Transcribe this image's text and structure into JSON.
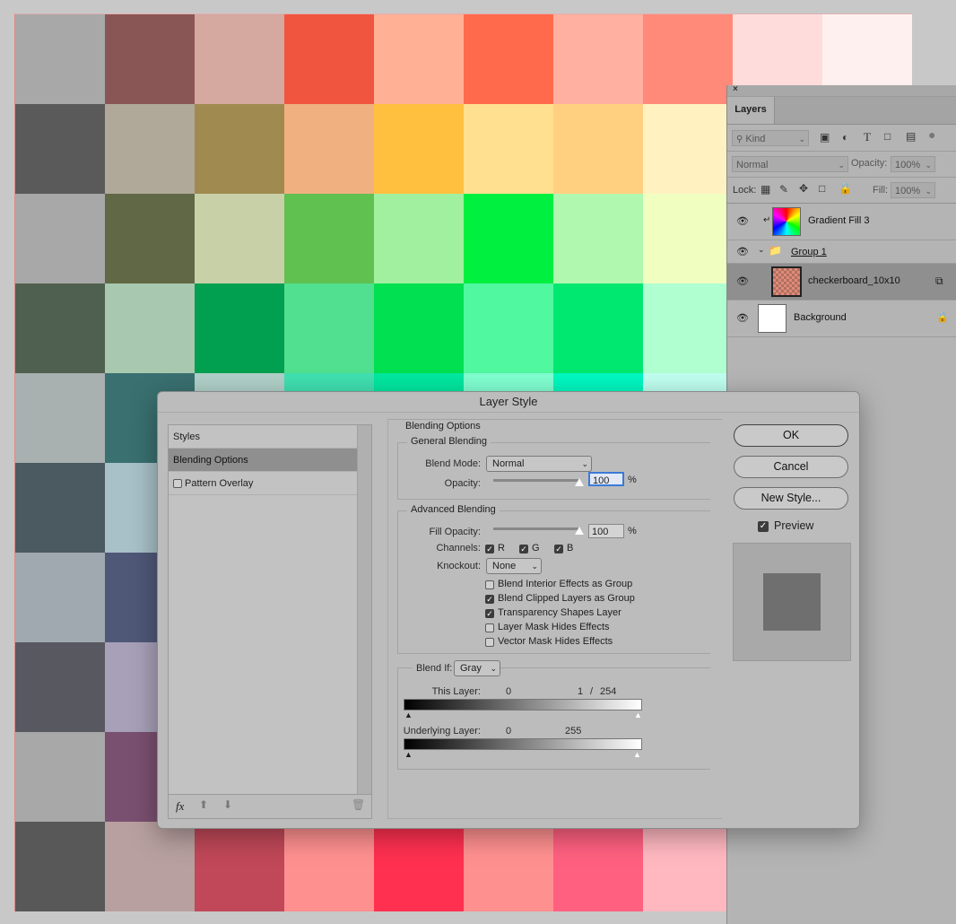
{
  "canvas_colors": [
    "#a8a8a8",
    "#8a5555",
    "#d5a8a0",
    "#f05540",
    "#ffb095",
    "#ff6a4d",
    "#ffb0a0",
    "#ff8a7a",
    "#ffdcdc",
    "#fff0f0",
    "#5a5a5a",
    "#b0a898",
    "#a08a50",
    "#f0b080",
    "#ffc040",
    "#ffe090",
    "#ffd080",
    "#fff2c0",
    "#f0f0d0",
    "#ffffff",
    "#a8a8a8",
    "#606845",
    "#c8d0a8",
    "#60c050",
    "#a0f0a0",
    "#00f040",
    "#b0f8b0",
    "#f0ffc0",
    "#f0fff0",
    "#f8fff8",
    "#506050",
    "#a8c8b0",
    "#00a050",
    "#50e090",
    "#00e050",
    "#50f8a0",
    "#00e870",
    "#b0ffd0",
    "#d0ffe0",
    "#e0fff0",
    "#a8b0b0",
    "#3a7070",
    "#b0d0c8",
    "#40e0b0",
    "#00e8a0",
    "#80ffd0",
    "#00f8c0",
    "#c0fff0",
    "#e0fff8",
    "#f0fffc",
    "#4a5a60",
    "#a8c0c8",
    "#386068",
    "#a0c8d0",
    "#50a0b0",
    "#c0d8e0",
    "#6080a0",
    "#d0e0f0",
    "#e0e8f8",
    "#f0f4ff",
    "#a0a8b0",
    "#505878",
    "#b8b8c8",
    "#7070a0",
    "#c8c0e0",
    "#9090c0",
    "#d8d0f0",
    "#c0a8e0",
    "#ece0f8",
    "#f8f0ff",
    "#585860",
    "#a8a0b8",
    "#705878",
    "#c8a8c8",
    "#906090",
    "#e8b8e0",
    "#c080b0",
    "#f0c8e8",
    "#f8e0f0",
    "#fff0fa",
    "#a8a8a8",
    "#7a5070",
    "#c0a0b0",
    "#b04080",
    "#f0a0c8",
    "#ff3080",
    "#ffa8d0",
    "#ff80b0",
    "#ffd0e8",
    "#fff0f6",
    "#585858",
    "#b8a0a0",
    "#c04858",
    "#ff9090",
    "#ff3050",
    "#ff9090",
    "#ff6080",
    "#ffb8c0",
    "#ffd8d8",
    "#fff4f4"
  ],
  "layers_panel": {
    "close_glyph": "×",
    "tab_label": "Layers",
    "kind_label": "Kind",
    "blend_mode": "Normal",
    "opacity_label": "Opacity:",
    "opacity_value": "100%",
    "lock_label": "Lock:",
    "fill_label": "Fill:",
    "fill_value": "100%",
    "layers": [
      {
        "name": "Gradient Fill 3"
      },
      {
        "name": "Group 1"
      },
      {
        "name": "checkerboard_10x10"
      },
      {
        "name": "Background"
      }
    ]
  },
  "dialog": {
    "title": "Layer Style",
    "styles_header": "Styles",
    "styles_items": [
      "Blending Options",
      "Pattern Overlay"
    ],
    "fx_label": "fx",
    "blending_options_title": "Blending Options",
    "general_blending": {
      "title": "General Blending",
      "blend_mode_label": "Blend Mode:",
      "blend_mode_value": "Normal",
      "opacity_label": "Opacity:",
      "opacity_value": "100",
      "percent": "%",
      "opacity_level": 100
    },
    "advanced_blending": {
      "title": "Advanced Blending",
      "fill_opacity_label": "Fill Opacity:",
      "fill_opacity_value": "100",
      "percent": "%",
      "fill_opacity_level": 100,
      "channels_label": "Channels:",
      "channels": [
        "R",
        "G",
        "B"
      ],
      "knockout_label": "Knockout:",
      "knockout_value": "None",
      "options": [
        {
          "label": "Blend Interior Effects as Group",
          "checked": false
        },
        {
          "label": "Blend Clipped Layers as Group",
          "checked": true
        },
        {
          "label": "Transparency Shapes Layer",
          "checked": true
        },
        {
          "label": "Layer Mask Hides Effects",
          "checked": false
        },
        {
          "label": "Vector Mask Hides Effects",
          "checked": false
        }
      ]
    },
    "blend_if": {
      "label": "Blend If:",
      "value": "Gray",
      "this_layer_label": "This Layer:",
      "this_layer_low": "0",
      "this_layer_mid": "1",
      "this_layer_sep": "/",
      "this_layer_high": "254",
      "underlying_label": "Underlying Layer:",
      "underlying_low": "0",
      "underlying_high": "255"
    },
    "buttons": {
      "ok": "OK",
      "cancel": "Cancel",
      "new_style": "New Style..."
    },
    "preview_label": "Preview",
    "preview_checked": true
  }
}
